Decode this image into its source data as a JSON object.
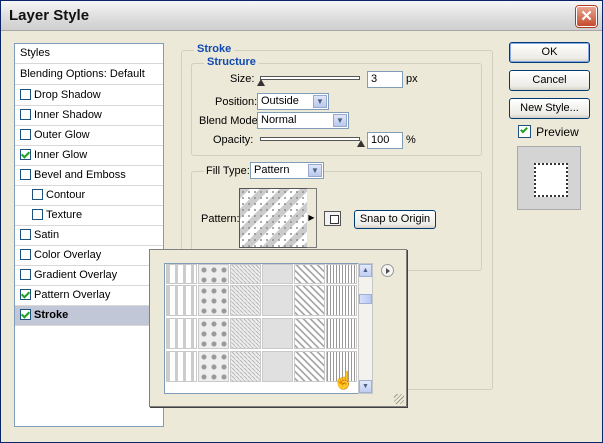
{
  "window": {
    "title": "Layer Style"
  },
  "styles_list": {
    "header": "Styles",
    "blending": "Blending Options: Default",
    "items": [
      {
        "label": "Drop Shadow",
        "checked": false
      },
      {
        "label": "Inner Shadow",
        "checked": false
      },
      {
        "label": "Outer Glow",
        "checked": false
      },
      {
        "label": "Inner Glow",
        "checked": true
      },
      {
        "label": "Bevel and Emboss",
        "checked": false
      },
      {
        "label": "Contour",
        "checked": false,
        "indent": true
      },
      {
        "label": "Texture",
        "checked": false,
        "indent": true
      },
      {
        "label": "Satin",
        "checked": false
      },
      {
        "label": "Color Overlay",
        "checked": false
      },
      {
        "label": "Gradient Overlay",
        "checked": false
      },
      {
        "label": "Pattern Overlay",
        "checked": true
      },
      {
        "label": "Stroke",
        "checked": true,
        "selected": true
      }
    ]
  },
  "stroke": {
    "group_title": "Stroke",
    "structure_title": "Structure",
    "size_label": "Size:",
    "size_value": "3",
    "size_unit": "px",
    "position_label": "Position:",
    "position_value": "Outside",
    "blend_mode_label": "Blend Mode:",
    "blend_mode_value": "Normal",
    "opacity_label": "Opacity:",
    "opacity_value": "100",
    "opacity_unit": "%",
    "fill_type_label": "Fill Type:",
    "fill_type_value": "Pattern",
    "pattern_label": "Pattern:",
    "snap_label": "Snap to Origin"
  },
  "buttons": {
    "ok": "OK",
    "cancel": "Cancel",
    "new_style": "New Style...",
    "preview": "Preview"
  },
  "icons": {
    "close": "close-icon",
    "checkbox": "checkbox-icon",
    "dropdown": "chevron-down-icon",
    "menu": "popup-menu-icon",
    "cursor": "hand-cursor-icon"
  },
  "colors": {
    "accent": "#1048b4",
    "selected_row": "#c1c7d7",
    "check": "#21a121"
  }
}
